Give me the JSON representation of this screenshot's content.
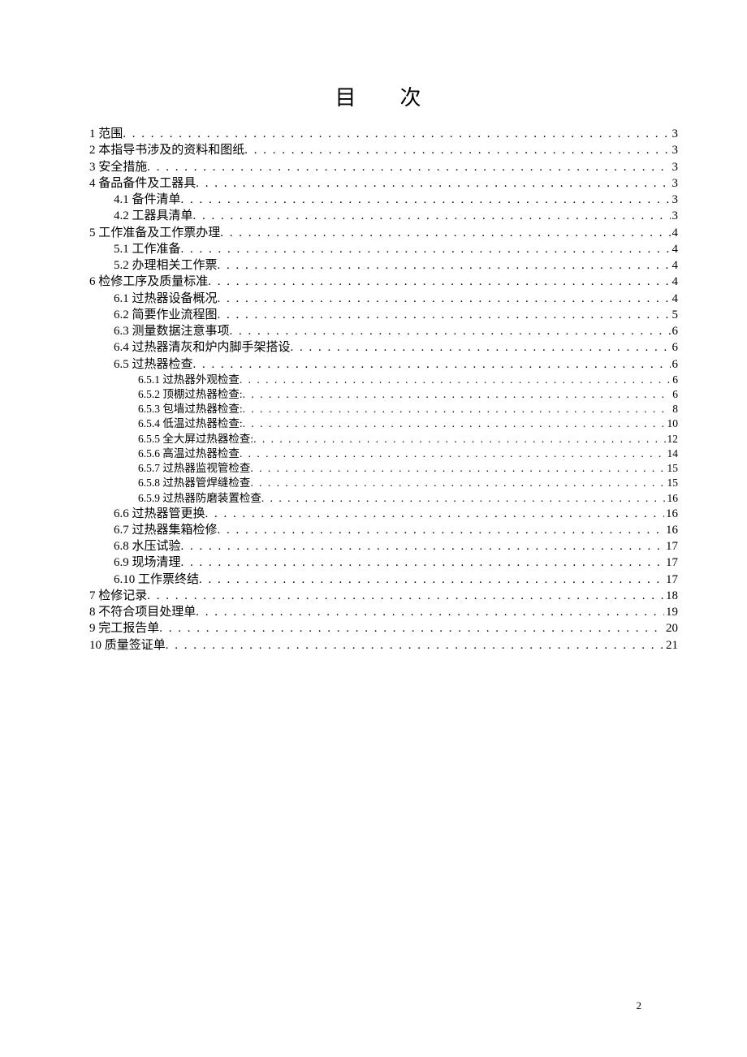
{
  "title": "目　次",
  "page_number": "2",
  "toc": [
    {
      "level": 1,
      "label": "1 范围",
      "page": "3"
    },
    {
      "level": 1,
      "label": "2 本指导书涉及的资料和图纸",
      "page": "3"
    },
    {
      "level": 1,
      "label": "3 安全措施",
      "page": "3"
    },
    {
      "level": 1,
      "label": "4 备品备件及工器具",
      "page": "3"
    },
    {
      "level": 2,
      "label": "4.1 备件清单",
      "page": "3"
    },
    {
      "level": 2,
      "label": "4.2 工器具清单",
      "page": "3"
    },
    {
      "level": 1,
      "label": "5 工作准备及工作票办理",
      "page": "4"
    },
    {
      "level": 2,
      "label": "5.1 工作准备",
      "page": "4"
    },
    {
      "level": 2,
      "label": "5.2 办理相关工作票",
      "page": "4"
    },
    {
      "level": 1,
      "label": "6 检修工序及质量标准",
      "page": "4"
    },
    {
      "level": 2,
      "label": "6.1 过热器设备概况",
      "page": "4"
    },
    {
      "level": 2,
      "label": "6.2 简要作业流程图",
      "page": "5"
    },
    {
      "level": 2,
      "label": "6.3 测量数据注意事项",
      "page": "6"
    },
    {
      "level": 2,
      "label": "6.4 过热器清灰和炉内脚手架搭设",
      "page": "6"
    },
    {
      "level": 2,
      "label": "6.5 过热器检查",
      "page": "6"
    },
    {
      "level": 3,
      "label": "6.5.1 过热器外观检查 ",
      "page": "6"
    },
    {
      "level": 3,
      "label": "6.5.2 顶棚过热器检查: ",
      "page": "6"
    },
    {
      "level": 3,
      "label": "6.5.3 包墙过热器检查: ",
      "page": "8"
    },
    {
      "level": 3,
      "label": "6.5.4 低温过热器检查: ",
      "page": "10"
    },
    {
      "level": 3,
      "label": "6.5.5 全大屏过热器检查: ",
      "page": "12"
    },
    {
      "level": 3,
      "label": "6.5.6 高温过热器检查 ",
      "page": "14"
    },
    {
      "level": 3,
      "label": "6.5.7 过热器监视管检查 ",
      "page": "15"
    },
    {
      "level": 3,
      "label": "6.5.8 过热器管焊缝检查 ",
      "page": "15"
    },
    {
      "level": 3,
      "label": "6.5.9 过热器防磨装置检查 ",
      "page": "16"
    },
    {
      "level": 2,
      "label": "6.6 过热器管更换",
      "page": "16"
    },
    {
      "level": 2,
      "label": "6.7 过热器集箱检修",
      "page": "16"
    },
    {
      "level": 2,
      "label": "6.8 水压试验",
      "page": "17"
    },
    {
      "level": 2,
      "label": "6.9 现场清理",
      "page": "17"
    },
    {
      "level": 2,
      "label": "6.10 工作票终结",
      "page": "17"
    },
    {
      "level": 1,
      "label": "7 检修记录",
      "page": "18"
    },
    {
      "level": 1,
      "label": "8 不符合项目处理单",
      "page": "19"
    },
    {
      "level": 1,
      "label": "9 完工报告单",
      "page": "20"
    },
    {
      "level": 1,
      "label": "10 质量签证单",
      "page": "21"
    }
  ]
}
